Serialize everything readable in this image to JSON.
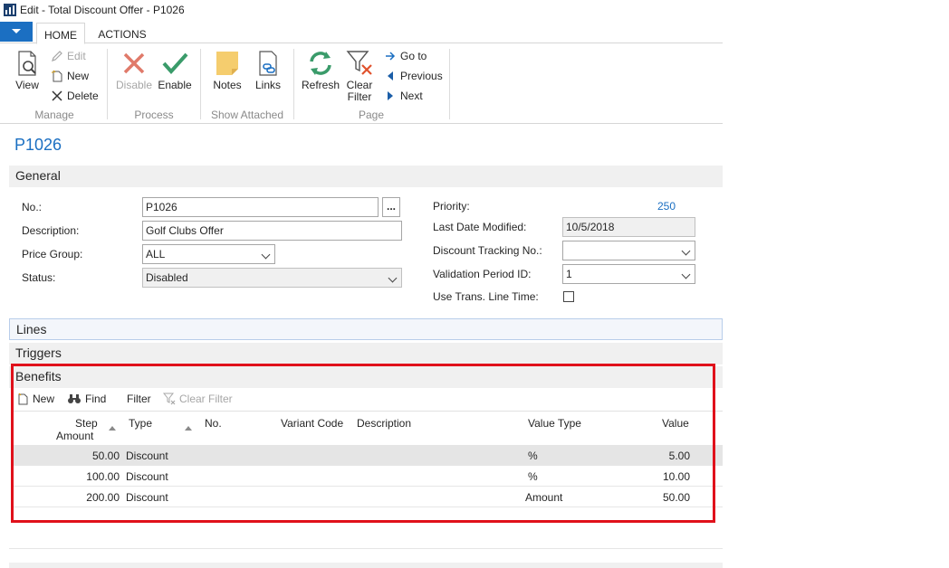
{
  "window": {
    "title": "Edit - Total Discount Offer - P1026"
  },
  "ribbon": {
    "tabs": [
      {
        "label": "HOME"
      },
      {
        "label": "ACTIONS"
      }
    ],
    "groups": {
      "manage": {
        "label": "Manage",
        "view": "View",
        "edit": "Edit",
        "new": "New",
        "delete": "Delete"
      },
      "process": {
        "label": "Process",
        "disable": "Disable",
        "enable": "Enable"
      },
      "show_attached": {
        "label": "Show Attached",
        "notes": "Notes",
        "links": "Links"
      },
      "page": {
        "label": "Page",
        "refresh": "Refresh",
        "clear_filter_1": "Clear",
        "clear_filter_2": "Filter",
        "go_to": "Go to",
        "previous": "Previous",
        "next": "Next"
      }
    }
  },
  "page_title": "P1026",
  "fasttabs": {
    "general": "General",
    "lines": "Lines",
    "triggers": "Triggers",
    "benefits": "Benefits"
  },
  "general": {
    "no_label": "No.:",
    "no_value": "P1026",
    "no_assist": "...",
    "description_label": "Description:",
    "description_value": "Golf Clubs Offer",
    "price_group_label": "Price Group:",
    "price_group_value": "ALL",
    "status_label": "Status:",
    "status_value": "Disabled",
    "priority_label": "Priority:",
    "priority_value": "250",
    "last_modified_label": "Last Date Modified:",
    "last_modified_value": "10/5/2018",
    "tracking_label": "Discount Tracking No.:",
    "tracking_value": "",
    "validation_label": "Validation Period ID:",
    "validation_value": "1",
    "use_trans_label": "Use Trans. Line Time:",
    "use_trans_checked": false
  },
  "benefits": {
    "toolbar": {
      "new": "New",
      "find": "Find",
      "filter": "Filter",
      "clear_filter": "Clear Filter"
    },
    "columns": {
      "step_amount_1": "Step",
      "step_amount_2": "Amount",
      "type": "Type",
      "no": "No.",
      "variant_code": "Variant Code",
      "description": "Description",
      "value_type": "Value Type",
      "value": "Value"
    },
    "rows": [
      {
        "step_amount": "50.00",
        "type": "Discount",
        "no": "",
        "variant_code": "",
        "description": "",
        "value_type": "%",
        "value": "5.00"
      },
      {
        "step_amount": "100.00",
        "type": "Discount",
        "no": "",
        "variant_code": "",
        "description": "",
        "value_type": "%",
        "value": "10.00"
      },
      {
        "step_amount": "200.00",
        "type": "Discount",
        "no": "",
        "variant_code": "",
        "description": "",
        "value_type": "Amount",
        "value": "50.00"
      }
    ]
  },
  "colors": {
    "accent": "#1b6fc2",
    "highlight_border": "#e0111b",
    "enable_green": "#3a9b6a",
    "disable_red": "#e07a6a",
    "notes_yellow": "#f5cd6e"
  }
}
